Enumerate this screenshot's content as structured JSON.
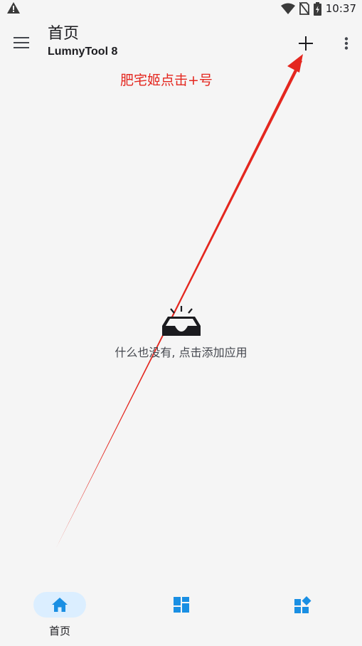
{
  "status_bar": {
    "time": "10:37",
    "icons": [
      "warning-icon",
      "wifi-icon",
      "no-sim-icon",
      "battery-charging-icon"
    ]
  },
  "app_bar": {
    "title": "首页",
    "subtitle": "LumnyTool 8",
    "icons": [
      "menu-icon",
      "add-icon",
      "more-vert-icon"
    ]
  },
  "annotation": {
    "text": "肥宅姬点击+号",
    "color": "#e4271f"
  },
  "empty_state": {
    "icon": "empty-inbox-icon",
    "message": "什么也没有, 点击添加应用"
  },
  "bottom_nav": {
    "accent": "#1a8fe3",
    "items": [
      {
        "icon": "home-icon",
        "label": "首页",
        "active": true
      },
      {
        "icon": "dashboard-icon",
        "label": "",
        "active": false
      },
      {
        "icon": "widgets-icon",
        "label": "",
        "active": false
      }
    ]
  }
}
